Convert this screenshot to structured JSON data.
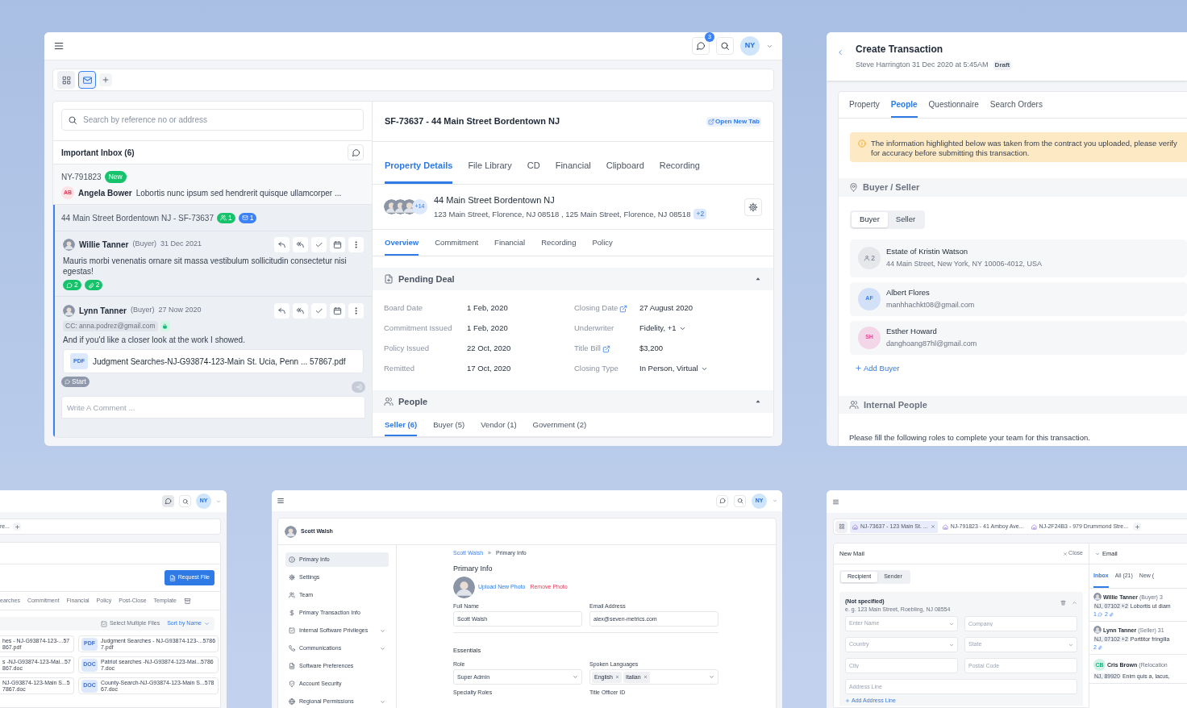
{
  "inbox_window": {
    "notification_count": "3",
    "avatar": "NY",
    "view_tabs": [
      {
        "kind": "grid",
        "selected": false
      },
      {
        "kind": "mail",
        "selected": true
      }
    ],
    "search": {
      "placeholder": "Search by reference no or address"
    },
    "inbox_title": "Important Inbox (6)",
    "new_item": {
      "ref": "NY-791823",
      "badge": "New",
      "initials": "AB",
      "sender": "Angela Bower",
      "preview": "Lobortis nunc ipsum sed hendrerit quisque ullamcorper ..."
    },
    "thread": {
      "title": "44 Main Street Bordentown NJ - SF-73637",
      "people_count": "1",
      "mail_count": "1",
      "messages": [
        {
          "sender": "Willie Tanner",
          "role": "(Buyer)",
          "date": "31 Dec 2021",
          "body": "Mauris morbi venenatis ornare sit massa vestibulum sollicitudin consectetur nisi egestas!",
          "comment_count": "2",
          "attachment_count": "2"
        },
        {
          "sender": "Lynn Tanner",
          "role": "(Buyer)",
          "date": "27 Now 2020",
          "cc": "CC: anna.podrez@gmail.com",
          "body": "And if you'd like a closer look at the work I showed.",
          "attachment": {
            "type": "PDF",
            "name": "Judgment Searches-NJ-G93874-123-Main St. Ucia, Penn ... 57867.pdf"
          }
        }
      ],
      "start_label": "Start",
      "comment_placeholder": "Write A Comment ..."
    },
    "detail": {
      "title": "SF-73637 - 44 Main Street Bordentown NJ",
      "open_new_tab": "Open New Tab",
      "tabs": [
        {
          "label": "Property Details",
          "selected": true
        },
        {
          "label": "File Library",
          "selected": false
        },
        {
          "label": "CD",
          "selected": false
        },
        {
          "label": "Financial",
          "selected": false
        },
        {
          "label": "Clipboard",
          "selected": false
        },
        {
          "label": "Recording",
          "selected": false
        }
      ],
      "property": {
        "avatar_more": "+14",
        "name": "44 Main Street Bordentown NJ",
        "addresses": "123 Main Street, Florence, NJ 08518 , 125 Main Street, Florence, NJ 08518",
        "more": "+2"
      },
      "sub_tabs": [
        {
          "label": "Overview",
          "selected": true
        },
        {
          "label": "Commitment",
          "selected": false
        },
        {
          "label": "Financial",
          "selected": false
        },
        {
          "label": "Recording",
          "selected": false
        },
        {
          "label": "Policy",
          "selected": false
        }
      ],
      "pending_deal": {
        "title": "Pending Deal",
        "expanded": true,
        "fields": [
          {
            "label": "Board Date",
            "value": "1 Feb, 2020",
            "kind": "plain"
          },
          {
            "label": "Closing Date",
            "value": "27 August 2020",
            "kind": "link"
          },
          {
            "label": "Commitment Issued",
            "value": "1 Feb, 2020",
            "kind": "plain"
          },
          {
            "label": "Underwriter",
            "value": "Fidelity, +1",
            "kind": "select"
          },
          {
            "label": "Policy Issued",
            "value": "22 Oct, 2020",
            "kind": "plain"
          },
          {
            "label": "Title Bill",
            "value": "$3,200",
            "kind": "link"
          },
          {
            "label": "Remitted",
            "value": "17 Oct, 2020",
            "kind": "plain"
          },
          {
            "label": "Closing Type",
            "value": "In Person, Virtual",
            "kind": "select"
          }
        ]
      },
      "people": {
        "title": "People",
        "expanded": true,
        "tabs": [
          {
            "label": "Seller (6)",
            "selected": true
          },
          {
            "label": "Buyer (5)",
            "selected": false
          },
          {
            "label": "Vendor (1)",
            "selected": false
          },
          {
            "label": "Government (2)",
            "selected": false
          }
        ]
      }
    }
  },
  "transaction_window": {
    "title": "Create Transaction",
    "subtitle": "Steve Harrington 31 Dec 2020 at 5:45AM",
    "status": "Draft",
    "tabs": [
      {
        "label": "Property",
        "selected": false
      },
      {
        "label": "People",
        "selected": true
      },
      {
        "label": "Questionnaire",
        "selected": false
      },
      {
        "label": "Search Orders",
        "selected": false
      }
    ],
    "notice": "The information highlighted below was taken from the contract you uploaded, please verify for accuracy before submitting this transaction.",
    "buyer_seller": {
      "title": "Buyer / Seller",
      "toggle": [
        {
          "label": "Buyer",
          "selected": true
        },
        {
          "label": "Seller",
          "selected": false
        }
      ],
      "parties": [
        {
          "kind": "group",
          "count": "2",
          "name": "Estate of Kristin Watson",
          "detail": "44 Main Street, New York, NY 10006-4012, USA"
        },
        {
          "kind": "initials",
          "initials": "AF",
          "color": "#3b82f6",
          "name": "Albert Flores",
          "detail": "manhhachkt08@gmail.com"
        },
        {
          "kind": "initials",
          "initials": "SH",
          "color": "#ec4899",
          "name": "Esther Howard",
          "detail": "danghoang87hl@gmail.com"
        }
      ],
      "add_label": "Add Buyer"
    },
    "internal_people": {
      "title": "Internal People",
      "hint": "Please fill the following roles to complete your team for this transaction."
    }
  },
  "files_window": {
    "avatar": "NY",
    "tab_fragment": "re...",
    "request_button": "Request File",
    "categories": [
      {
        "label": "earches",
        "selected": false
      },
      {
        "label": "Commitment",
        "selected": false
      },
      {
        "label": "Financial",
        "selected": false
      },
      {
        "label": "Policy",
        "selected": false
      },
      {
        "label": "Post-Close",
        "selected": false
      },
      {
        "label": "Template",
        "selected": false
      }
    ],
    "select_multiple": "Select Multiple Files",
    "sort": "Sort by Name",
    "files": [
      {
        "name": "hes - NJ-G93874-123-...57867.pdf"
      },
      {
        "type": "PDF",
        "name": "Judgment Searches - NJ-G93874-123-...57867.pdf"
      },
      {
        "name": "s -NJ-G93874-123-Mai...57867.doc"
      },
      {
        "type": "DOC",
        "name": "Patriot searches -NJ-G93874-123-Mai...57867.doc"
      },
      {
        "name": "NJ-G93874-123-Main S...57867.doc"
      },
      {
        "type": "DOC",
        "name": "County-Search-NJ-G93874-123-Main S...57867.doc"
      }
    ]
  },
  "profile_window": {
    "avatar": "NY",
    "user": "Scott Walsh",
    "menu": [
      {
        "label": "Primary Info",
        "selected": true,
        "expandable": false
      },
      {
        "label": "Settings",
        "selected": false,
        "expandable": false
      },
      {
        "label": "Team",
        "selected": false,
        "expandable": false
      },
      {
        "label": "Primary Transaction Info",
        "selected": false,
        "expandable": false
      },
      {
        "label": "Internal Software Privileges",
        "selected": false,
        "expandable": true
      },
      {
        "label": "Communications",
        "selected": false,
        "expandable": true
      },
      {
        "label": "Software Preferences",
        "selected": false,
        "expandable": false
      },
      {
        "label": "Account Security",
        "selected": false,
        "expandable": false
      },
      {
        "label": "Regional Permissions",
        "selected": false,
        "expandable": true
      }
    ],
    "breadcrumb": [
      "Scott Walsh",
      "Primary Info"
    ],
    "breadcrumb_separator": "»",
    "heading": "Primary Info",
    "upload": "Upload New Photo",
    "remove": "Remove Photo",
    "fields": [
      {
        "label": "Full Name",
        "value": "Scott Walsh"
      },
      {
        "label": "Email Address",
        "value": "alex@seven-metrics.com"
      }
    ],
    "essentials": "Essentials",
    "role": {
      "label": "Role",
      "value": "Super Admin"
    },
    "languages": {
      "label": "Spoken Languages",
      "values": [
        "English",
        "Italian"
      ]
    },
    "more_labels": [
      "Specialty Roles",
      "Title Officer ID"
    ]
  },
  "mail_window": {
    "tabs": [
      {
        "label": "NJ-73637 - 123 Main St. ...",
        "selected": true
      },
      {
        "label": "NJ-791823 - 41 Amboy Ave...",
        "selected": false
      },
      {
        "label": "NJ-2F24B3 - 979 Drummond Stre...",
        "selected": false
      }
    ],
    "new_mail": {
      "title": "New Mail",
      "close": "Close",
      "toggle": [
        {
          "label": "Recipient",
          "selected": true
        },
        {
          "label": "Sender",
          "selected": false
        }
      ],
      "recipient": {
        "name": "(Not specified)",
        "hint": "e. g. 123 Main Street, Roebling, NJ 08554",
        "fields": [
          {
            "placeholder": "Enter Name",
            "kind": "select"
          },
          {
            "placeholder": "Company",
            "kind": "text"
          },
          {
            "placeholder": "Country",
            "kind": "select"
          },
          {
            "placeholder": "State",
            "kind": "select"
          },
          {
            "placeholder": "City",
            "kind": "text"
          },
          {
            "placeholder": "Postal Code",
            "kind": "text"
          },
          {
            "placeholder": "Address Line",
            "kind": "wide"
          }
        ],
        "add": "Add Address Line"
      }
    },
    "email": {
      "title": "Email",
      "tabs": [
        {
          "label": "Inbox",
          "selected": true
        },
        {
          "label": "All (21)",
          "selected": false
        },
        {
          "label": "New (",
          "selected": false
        }
      ],
      "messages": [
        {
          "kind": "photo",
          "sender": "Willie Tanner",
          "role": "(Buyer) 3",
          "tag": "NJ, 07102 +2",
          "preview": "Lobortis ut diam",
          "comments": "1",
          "attachments": "2"
        },
        {
          "kind": "photo",
          "sender": "Lynn Tanner",
          "role": "(Seller) 31",
          "tag": "NJ, 07102 +2",
          "preview": "Porttitor fringilla",
          "attachments": "2"
        },
        {
          "kind": "initials",
          "initials": "CB",
          "color": "#10b981",
          "sender": "Cris Brown",
          "role": "(Relocation",
          "tag": "NJ, 89920",
          "preview": "Enim quis a, lacus,"
        }
      ]
    }
  }
}
